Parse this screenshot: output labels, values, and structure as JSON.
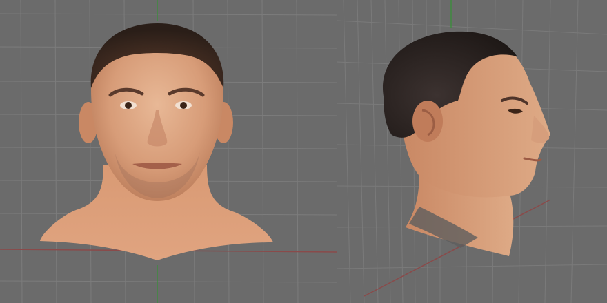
{
  "viewport_front": {
    "view": "front",
    "model": "head-mesh",
    "grid": true
  },
  "viewport_side": {
    "view": "side-perspective",
    "model": "head-mesh",
    "grid": true
  },
  "colors": {
    "background": "#6b6b6b",
    "grid_line": "#7a7a7a",
    "axis_green": "#3f8a3f",
    "axis_red": "#8a4040",
    "skin": "#d9a07c",
    "hair": "#2e2420"
  }
}
